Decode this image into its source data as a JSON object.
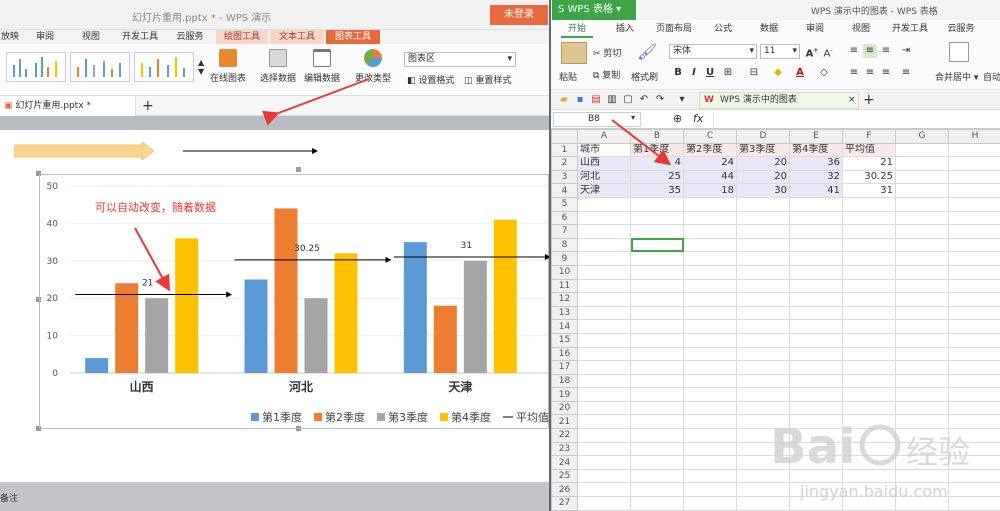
{
  "left": {
    "title": "幻灯片重用.pptx * - WPS 演示",
    "login": "未登录",
    "menu": [
      "放映",
      "审阅",
      "视图",
      "开发工具",
      "云服务",
      "绘图工具",
      "文本工具",
      "图表工具"
    ],
    "ribbon": {
      "online_chart": "在线图表",
      "select_data": "选择数据",
      "edit_data": "编辑数据",
      "change_type": "更改类型",
      "chart_area": "图表区",
      "set_format": "设置格式",
      "reset_style": "重置样式"
    },
    "doc_tab": "幻灯片重用.pptx *",
    "notes": "备注"
  },
  "chart_data": {
    "type": "bar",
    "categories": [
      "山西",
      "河北",
      "天津"
    ],
    "series": [
      {
        "name": "第1季度",
        "values": [
          4,
          25,
          35
        ],
        "color": "#5b9bd5"
      },
      {
        "name": "第2季度",
        "values": [
          24,
          44,
          18
        ],
        "color": "#ed7d31"
      },
      {
        "name": "第3季度",
        "values": [
          20,
          20,
          30
        ],
        "color": "#a5a5a5"
      },
      {
        "name": "第4季度",
        "values": [
          36,
          32,
          41
        ],
        "color": "#ffc000"
      },
      {
        "name": "平均值",
        "values": [
          21,
          30.25,
          31
        ],
        "type": "line",
        "color": "#000000"
      }
    ],
    "data_labels": [
      "21",
      "30.25",
      "31"
    ],
    "ylim": [
      0,
      50
    ],
    "yticks": [
      0,
      10,
      20,
      30,
      40,
      50
    ],
    "legend_position": "bottom",
    "annotation": "可以自动改变，随着数据"
  },
  "right": {
    "app": "WPS 表格",
    "title": "WPS 演示中的图表 - WPS 表格",
    "menu": [
      "开始",
      "插入",
      "页面布局",
      "公式",
      "数据",
      "审阅",
      "视图",
      "开发工具",
      "云服务"
    ],
    "ribbon": {
      "cut": "剪切",
      "copy": "复制",
      "paste": "粘贴",
      "format_painter": "格式刷",
      "font": "宋体",
      "size": "11",
      "merge": "合并居中",
      "auto": "自动"
    },
    "doc_tab": "WPS 演示中的图表",
    "cell_ref": "B8",
    "fx": "fx",
    "columns": [
      "A",
      "B",
      "C",
      "D",
      "E",
      "F",
      "G",
      "H"
    ],
    "sheet": [
      [
        "城市",
        "第1季度",
        "第2季度",
        "第3季度",
        "第4季度",
        "平均值"
      ],
      [
        "山西",
        "4",
        "24",
        "20",
        "36",
        "21"
      ],
      [
        "河北",
        "25",
        "44",
        "20",
        "32",
        "30.25"
      ],
      [
        "天津",
        "35",
        "18",
        "30",
        "41",
        "31"
      ]
    ],
    "row_count": 27
  }
}
